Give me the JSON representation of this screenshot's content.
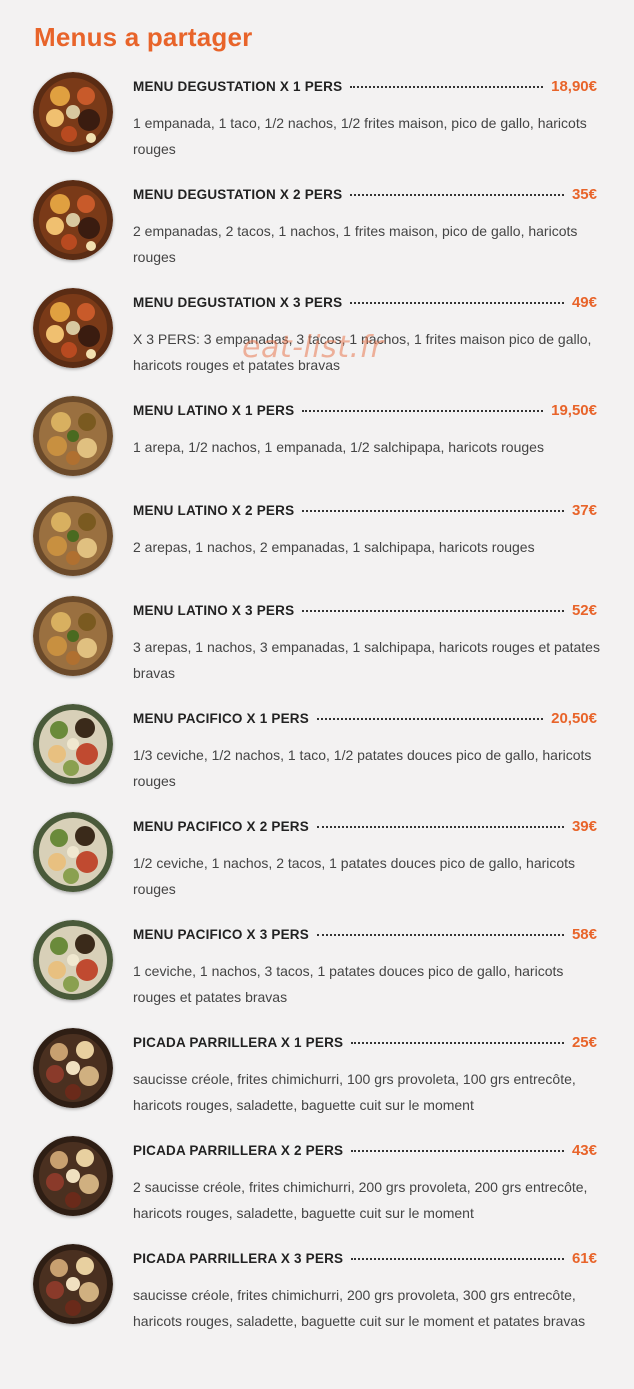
{
  "page_title": "Menus a partager",
  "watermark": "eat-list.fr",
  "colors": {
    "accent": "#e8642a",
    "background": "#f3f2f2",
    "text": "#3a3a3a"
  },
  "items": [
    {
      "name": "MENU DEGUSTATION X 1 PERS",
      "price": "18,90€",
      "desc": "1 empanada, 1 taco, 1/2 nachos, 1/2 frites maison, pico de gallo, haricots rouges",
      "image": "degustation-platter"
    },
    {
      "name": "MENU DEGUSTATION X 2 PERS",
      "price": "35€",
      "desc": "2 empanadas, 2 tacos, 1 nachos, 1 frites maison, pico de gallo, haricots rouges",
      "image": "degustation-platter"
    },
    {
      "name": "MENU DEGUSTATION X 3 PERS",
      "price": "49€",
      "desc": "X 3 PERS: 3 empanadas, 3 tacos, 1 nachos, 1 frites maison pico de gallo, haricots rouges et patates bravas",
      "image": "degustation-platter"
    },
    {
      "name": "MENU LATINO X 1 PERS",
      "price": "19,50€",
      "desc": "1 arepa, 1/2 nachos, 1 empanada, 1/2 salchipapa, haricots rouges",
      "image": "latino-platter"
    },
    {
      "name": "MENU LATINO X 2 PERS",
      "price": "37€",
      "desc": "2 arepas, 1 nachos, 2 empanadas, 1 salchipapa, haricots rouges",
      "image": "latino-platter"
    },
    {
      "name": "MENU LATINO X 3 PERS",
      "price": "52€",
      "desc": "3 arepas, 1 nachos, 3 empanadas, 1 salchipapa, haricots rouges et patates bravas",
      "image": "latino-platter"
    },
    {
      "name": "MENU PACIFICO X 1 PERS",
      "price": "20,50€",
      "desc": "1/3 ceviche, 1/2 nachos, 1 taco, 1/2 patates douces pico de gallo, haricots rouges",
      "image": "pacifico-platter"
    },
    {
      "name": "MENU PACIFICO X 2 PERS",
      "price": "39€",
      "desc": "1/2 ceviche, 1 nachos, 2 tacos, 1 patates douces pico de gallo, haricots rouges",
      "image": "pacifico-platter"
    },
    {
      "name": "MENU PACIFICO X 3 PERS",
      "price": "58€",
      "desc": "1 ceviche, 1 nachos, 3 tacos, 1 patates douces pico de gallo, haricots rouges et patates bravas",
      "image": "pacifico-platter"
    },
    {
      "name": "PICADA PARRILLERA X 1 PERS",
      "price": "25€",
      "desc": "saucisse créole, frites chimichurri, 100 grs provoleta, 100 grs entrecôte, haricots rouges, saladette, baguette cuit sur le moment",
      "image": "parrillera-platter"
    },
    {
      "name": "PICADA PARRILLERA X 2 PERS",
      "price": "43€",
      "desc": "2 saucisse créole, frites chimichurri, 200 grs provoleta, 200 grs entrecôte, haricots rouges, saladette, baguette cuit sur le moment",
      "image": "parrillera-platter"
    },
    {
      "name": "PICADA PARRILLERA X 3 PERS",
      "price": "61€",
      "desc": "saucisse créole, frites chimichurri, 200 grs provoleta, 300 grs entrecôte, haricots rouges, saladette, baguette cuit sur le moment et patates bravas",
      "image": "parrillera-platter"
    }
  ]
}
